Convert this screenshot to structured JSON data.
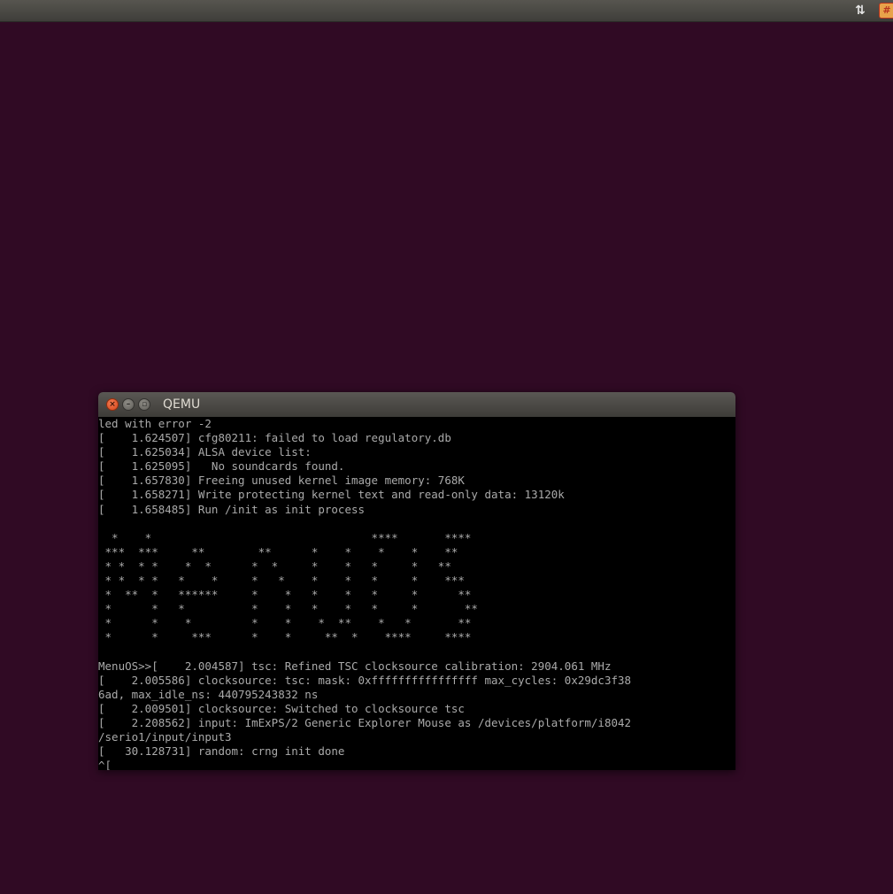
{
  "panel": {
    "network_icon": "transfer-arrows-icon",
    "indicator_icon": "app-indicator-icon",
    "network_glyph": "⇅",
    "indicator_glyph": "#"
  },
  "window": {
    "title": "QEMU",
    "close_glyph": "×",
    "minimize_glyph": "–",
    "maximize_glyph": "▫"
  },
  "console": {
    "lines": [
      "led with error -2",
      "[    1.624507] cfg80211: failed to load regulatory.db",
      "[    1.625034] ALSA device list:",
      "[    1.625095]   No soundcards found.",
      "[    1.657830] Freeing unused kernel image memory: 768K",
      "[    1.658271] Write protecting kernel text and read-only data: 13120k",
      "[    1.658485] Run /init as init process",
      "",
      "  *    *                                 ****       ****",
      " ***  ***     **        **      *    *    *    *    **",
      " * *  * *    *  *      *  *     *    *   *     *   **",
      " * *  * *   *    *     *   *    *    *   *     *    ***",
      " *  **  *   ******     *    *   *    *   *     *      **",
      " *      *   *          *    *   *    *   *     *       **",
      " *      *    *         *    *    *  **    *   *       **",
      " *      *     ***      *    *     **  *    ****     ****",
      "",
      "MenuOS>>[    2.004587] tsc: Refined TSC clocksource calibration: 2904.061 MHz",
      "[    2.005586] clocksource: tsc: mask: 0xffffffffffffffff max_cycles: 0x29dc3f38",
      "6ad, max_idle_ns: 440795243832 ns",
      "[    2.009501] clocksource: Switched to clocksource tsc",
      "[    2.208562] input: ImExPS/2 Generic Explorer Mouse as /devices/platform/i8042",
      "/serio1/input/input3",
      "[   30.128731] random: crng init done",
      "^[_"
    ]
  },
  "colors": {
    "desktop_bg": "#300a24",
    "console_bg": "#000000",
    "console_fg": "#aaaaaa"
  }
}
